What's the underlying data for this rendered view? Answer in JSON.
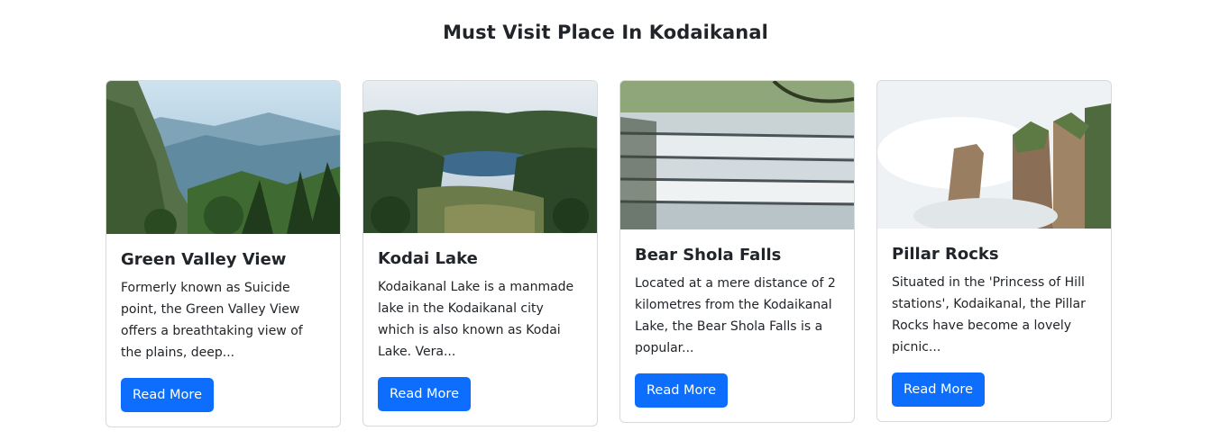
{
  "page": {
    "heading": "Must Visit Place In Kodaikanal"
  },
  "cards": [
    {
      "image_alt": "Green valley mountain view",
      "title": "Green Valley View",
      "text": "Formerly known as Suicide point, the Green Valley View offers a breathtaking view of the plains, deep...",
      "button": "Read More"
    },
    {
      "image_alt": "Lake surrounded by forest",
      "title": "Kodai Lake",
      "text": "Kodaikanal Lake is a manmade lake in the Kodaikanal city which is also known as Kodai Lake. Vera...",
      "button": "Read More"
    },
    {
      "image_alt": "Cascading waterfall",
      "title": "Bear Shola Falls",
      "text": "Located at a mere distance of 2 kilometres from the Kodaikanal Lake, the Bear Shola Falls is a popular...",
      "button": "Read More"
    },
    {
      "image_alt": "Misty rock pillars",
      "title": "Pillar Rocks",
      "text": "Situated in the 'Princess of Hill stations', Kodaikanal, the Pillar Rocks have become a lovely picnic...",
      "button": "Read More"
    }
  ]
}
